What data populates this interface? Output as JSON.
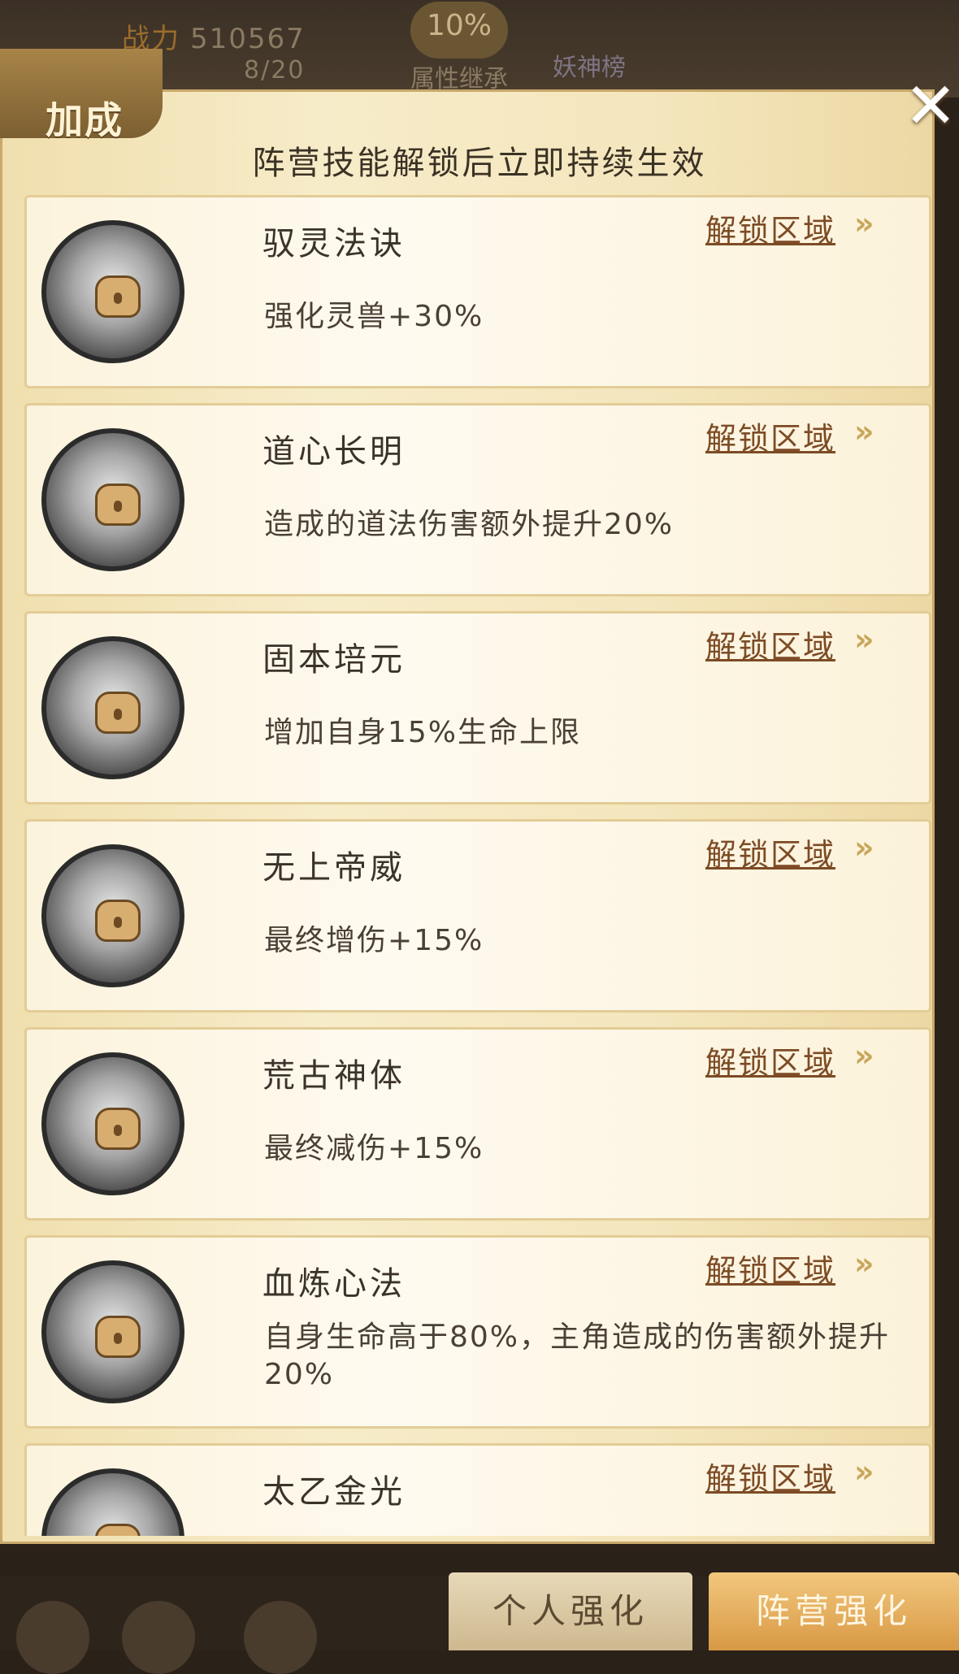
{
  "background": {
    "power_label": "战力",
    "power_value": "510567",
    "progress_text": "8/20",
    "attr_percent": "10%",
    "attr_label": "属性继承",
    "god_label": "妖神榜"
  },
  "panel": {
    "title": "加成",
    "subtitle": "阵营技能解锁后立即持续生效",
    "close_icon": "close-icon"
  },
  "skills": [
    {
      "name": "驭灵法诀",
      "desc": "强化灵兽+30%",
      "unlock": "解锁区域"
    },
    {
      "name": "道心长明",
      "desc": "造成的道法伤害额外提升20%",
      "unlock": "解锁区域"
    },
    {
      "name": "固本培元",
      "desc": "增加自身15%生命上限",
      "unlock": "解锁区域"
    },
    {
      "name": "无上帝威",
      "desc": "最终增伤+15%",
      "unlock": "解锁区域"
    },
    {
      "name": "荒古神体",
      "desc": "最终减伤+15%",
      "unlock": "解锁区域"
    },
    {
      "name": "血炼心法",
      "desc": "自身生命高于80%，主角造成的伤害额外提升20%",
      "unlock": "解锁区域"
    },
    {
      "name": "太乙金光",
      "desc": "",
      "unlock": "解锁区域"
    }
  ],
  "tabs": {
    "personal": "个人强化",
    "faction": "阵营强化"
  }
}
